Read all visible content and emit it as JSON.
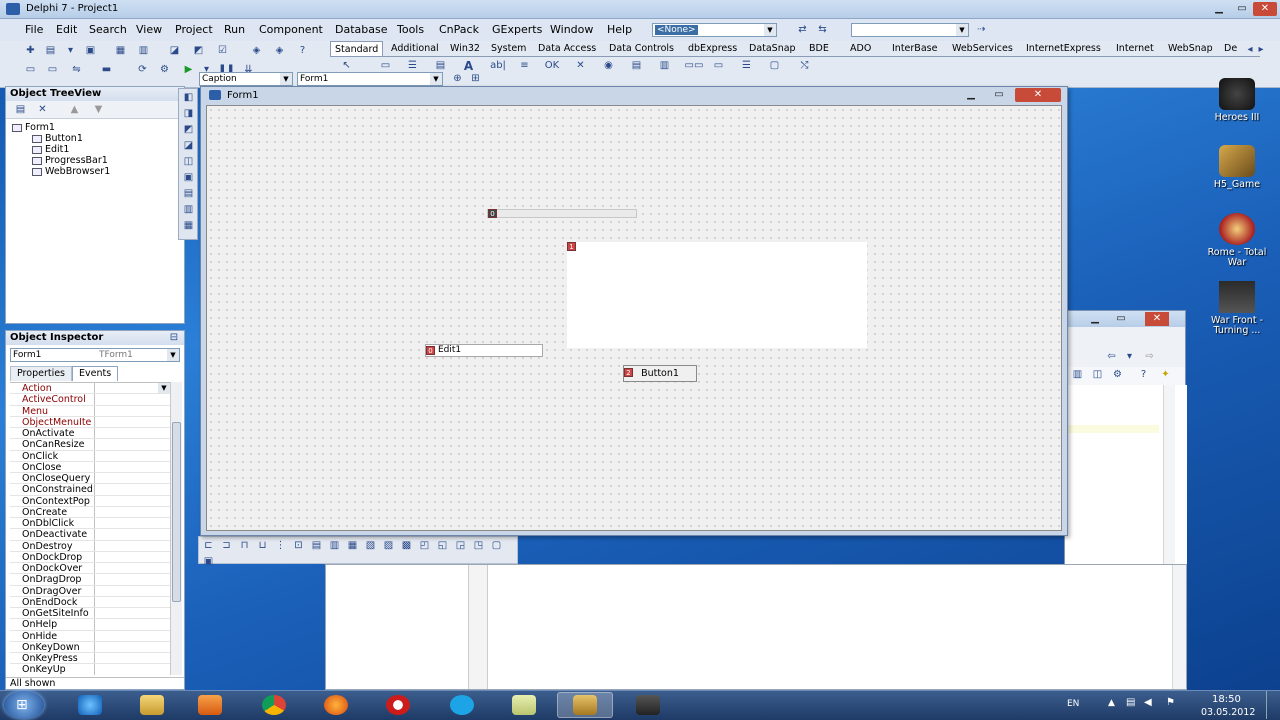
{
  "ide": {
    "title": "Delphi 7 - Project1",
    "menu": [
      "File",
      "Edit",
      "Search",
      "View",
      "Project",
      "Run",
      "Component",
      "Database",
      "Tools",
      "CnPack",
      "GExperts",
      "Window",
      "Help"
    ],
    "desktop_combo": "<None>",
    "palette_tabs": [
      "Standard",
      "Additional",
      "Win32",
      "System",
      "Data Access",
      "Data Controls",
      "dbExpress",
      "DataSnap",
      "BDE",
      "ADO",
      "InterBase",
      "WebServices",
      "InternetExpress",
      "Internet",
      "WebSnap",
      "De"
    ],
    "caption_combo": "Caption",
    "form_combo": "Form1"
  },
  "tree_view": {
    "title": "Object TreeView",
    "root": "Form1",
    "children": [
      "Button1",
      "Edit1",
      "ProgressBar1",
      "WebBrowser1"
    ]
  },
  "inspector": {
    "title": "Object Inspector",
    "object_name": "Form1",
    "object_type": "TForm1",
    "tab_properties": "Properties",
    "tab_events": "Events",
    "events": [
      "Action",
      "ActiveControl",
      "Menu",
      "ObjectMenuIte",
      "OnActivate",
      "OnCanResize",
      "OnClick",
      "OnClose",
      "OnCloseQuery",
      "OnConstrained",
      "OnContextPop",
      "OnCreate",
      "OnDblClick",
      "OnDeactivate",
      "OnDestroy",
      "OnDockDrop",
      "OnDockOver",
      "OnDragDrop",
      "OnDragOver",
      "OnEndDock",
      "OnGetSiteInfo",
      "OnHelp",
      "OnHide",
      "OnKeyDown",
      "OnKeyPress",
      "OnKeyUp"
    ],
    "status": "All shown"
  },
  "form": {
    "title": "Form1",
    "edit_text": "Edit1",
    "edit_badge": "0",
    "progress_badge": "0",
    "browser_badge": "1",
    "button_label": "Button1",
    "button_badge": "2"
  },
  "desktop_icons": [
    "Heroes III",
    "H5_Game",
    "Rome - Total War",
    "War Front - Turning ..."
  ],
  "tray": {
    "lang": "EN",
    "time": "18:50",
    "date": "03.05.2012"
  },
  "colors": {
    "accent": "#3a6ea5",
    "taskbar": "#1f3a66"
  }
}
